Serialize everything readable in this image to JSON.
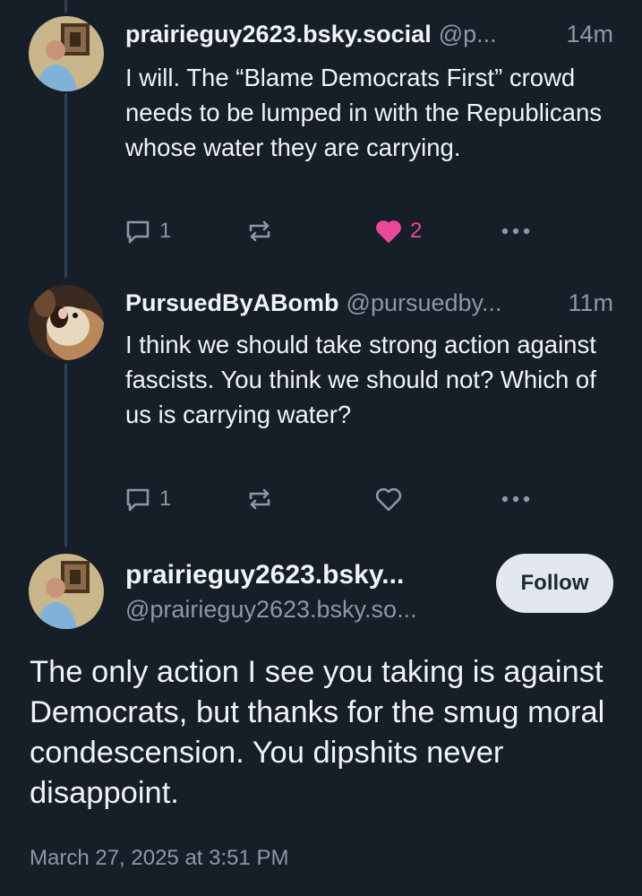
{
  "replies": [
    {
      "display_name": "prairieguy2623.bsky.social",
      "handle": "@p...",
      "time": "14m",
      "text": "I will. The “Blame Democrats First” crowd needs to be lumped in with the Republicans whose water they are carrying.",
      "reply_count": "1",
      "like_count": "2",
      "liked": true
    },
    {
      "display_name": "PursuedByABomb",
      "handle": "@pursuedby...",
      "time": "11m",
      "text": "I think we should take strong action against fascists. You think we should not? Which of us is carrying water?",
      "reply_count": "1",
      "like_count": "",
      "liked": false
    }
  ],
  "main_post": {
    "display_name": "prairieguy2623.bsky...",
    "handle": "@prairieguy2623.bsky.so...",
    "follow_label": "Follow",
    "text": "The only action I see you taking is against Democrats, but thanks for the smug moral condescension. You dipshits never disappoint.",
    "timestamp": "March 27, 2025 at 3:51 PM"
  },
  "icons": {
    "reply": "speech-bubble-icon",
    "repost": "repost-arrows-icon",
    "like": "heart-icon",
    "more": "ellipsis-icon"
  },
  "colors": {
    "background": "#161e27",
    "thread_line": "#2e4052",
    "muted_text": "#8b98a8",
    "like_active": "#ec4899",
    "follow_button_bg": "#e3e8ee"
  }
}
